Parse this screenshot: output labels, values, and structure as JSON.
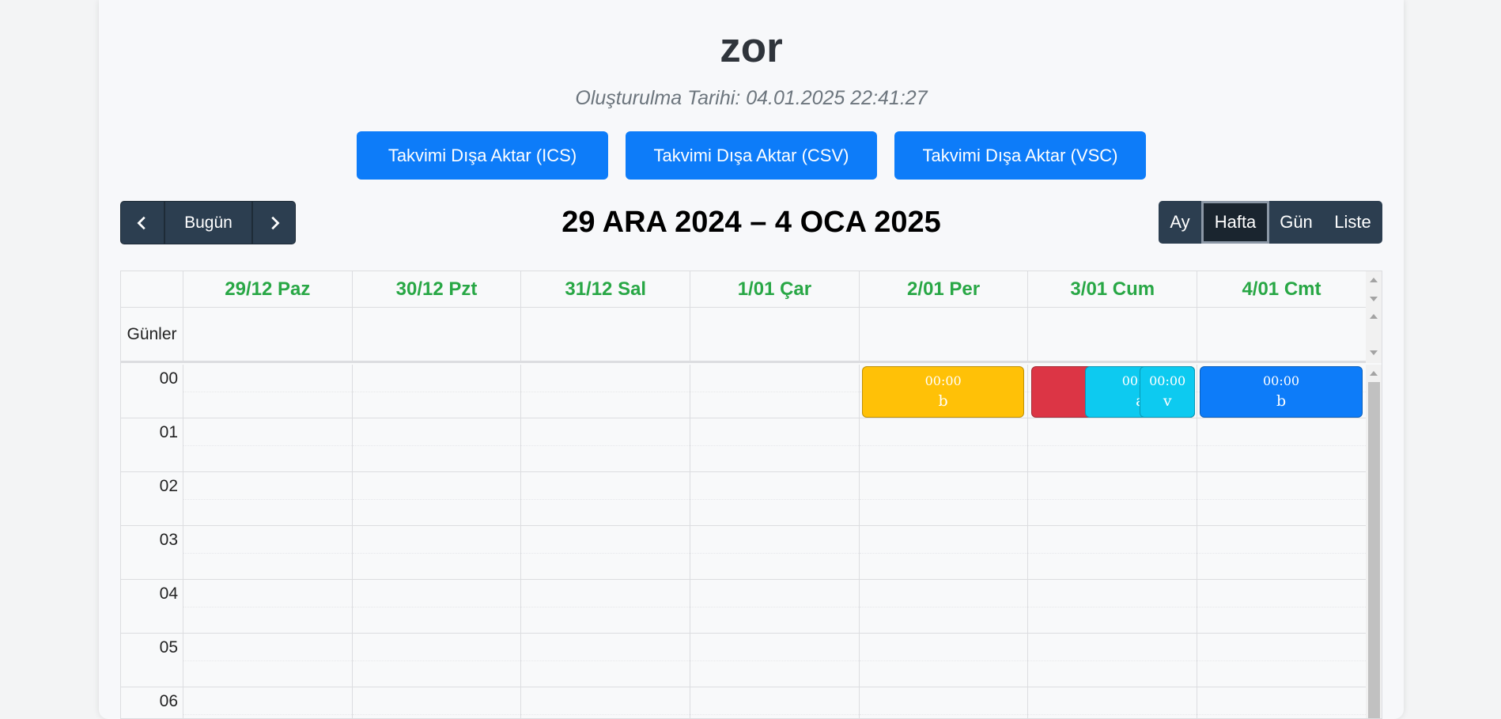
{
  "page": {
    "title": "zor",
    "subtitle": "Oluşturulma Tarihi: 04.01.2025 22:41:27"
  },
  "export_buttons": [
    "Takvimi Dışa Aktar (ICS)",
    "Takvimi Dışa Aktar (CSV)",
    "Takvimi Dışa Aktar (VSC)"
  ],
  "toolbar": {
    "today_label": "Bugün",
    "prev_icon": "chevron-left-icon",
    "next_icon": "chevron-right-icon",
    "range_title": "29 ARA 2024 – 4 OCA 2025",
    "views": [
      "Ay",
      "Hafta",
      "Gün",
      "Liste"
    ],
    "active_view": "Hafta"
  },
  "calendar": {
    "days": [
      "29/12 Paz",
      "30/12 Pzt",
      "31/12 Sal",
      "1/01 Çar",
      "2/01 Per",
      "3/01 Cum",
      "4/01 Cmt"
    ],
    "day_color": "#28a745",
    "allday_label": "Günler",
    "hours": [
      "00",
      "01",
      "02",
      "03",
      "04",
      "05",
      "06"
    ],
    "events": [
      {
        "day": 4,
        "time": "00:00",
        "title": "b",
        "color": "#ffc107"
      },
      {
        "day": 5,
        "time": "00:00",
        "title": "a",
        "color": "#dc3545"
      },
      {
        "day": 5,
        "time": "00:00",
        "title": "a",
        "color": "#0dcaf0"
      },
      {
        "day": 5,
        "time": "00:00",
        "title": "v",
        "color": "#0dcaf0"
      },
      {
        "day": 6,
        "time": "00:00",
        "title": "b",
        "color": "#0d7cf9"
      }
    ]
  }
}
